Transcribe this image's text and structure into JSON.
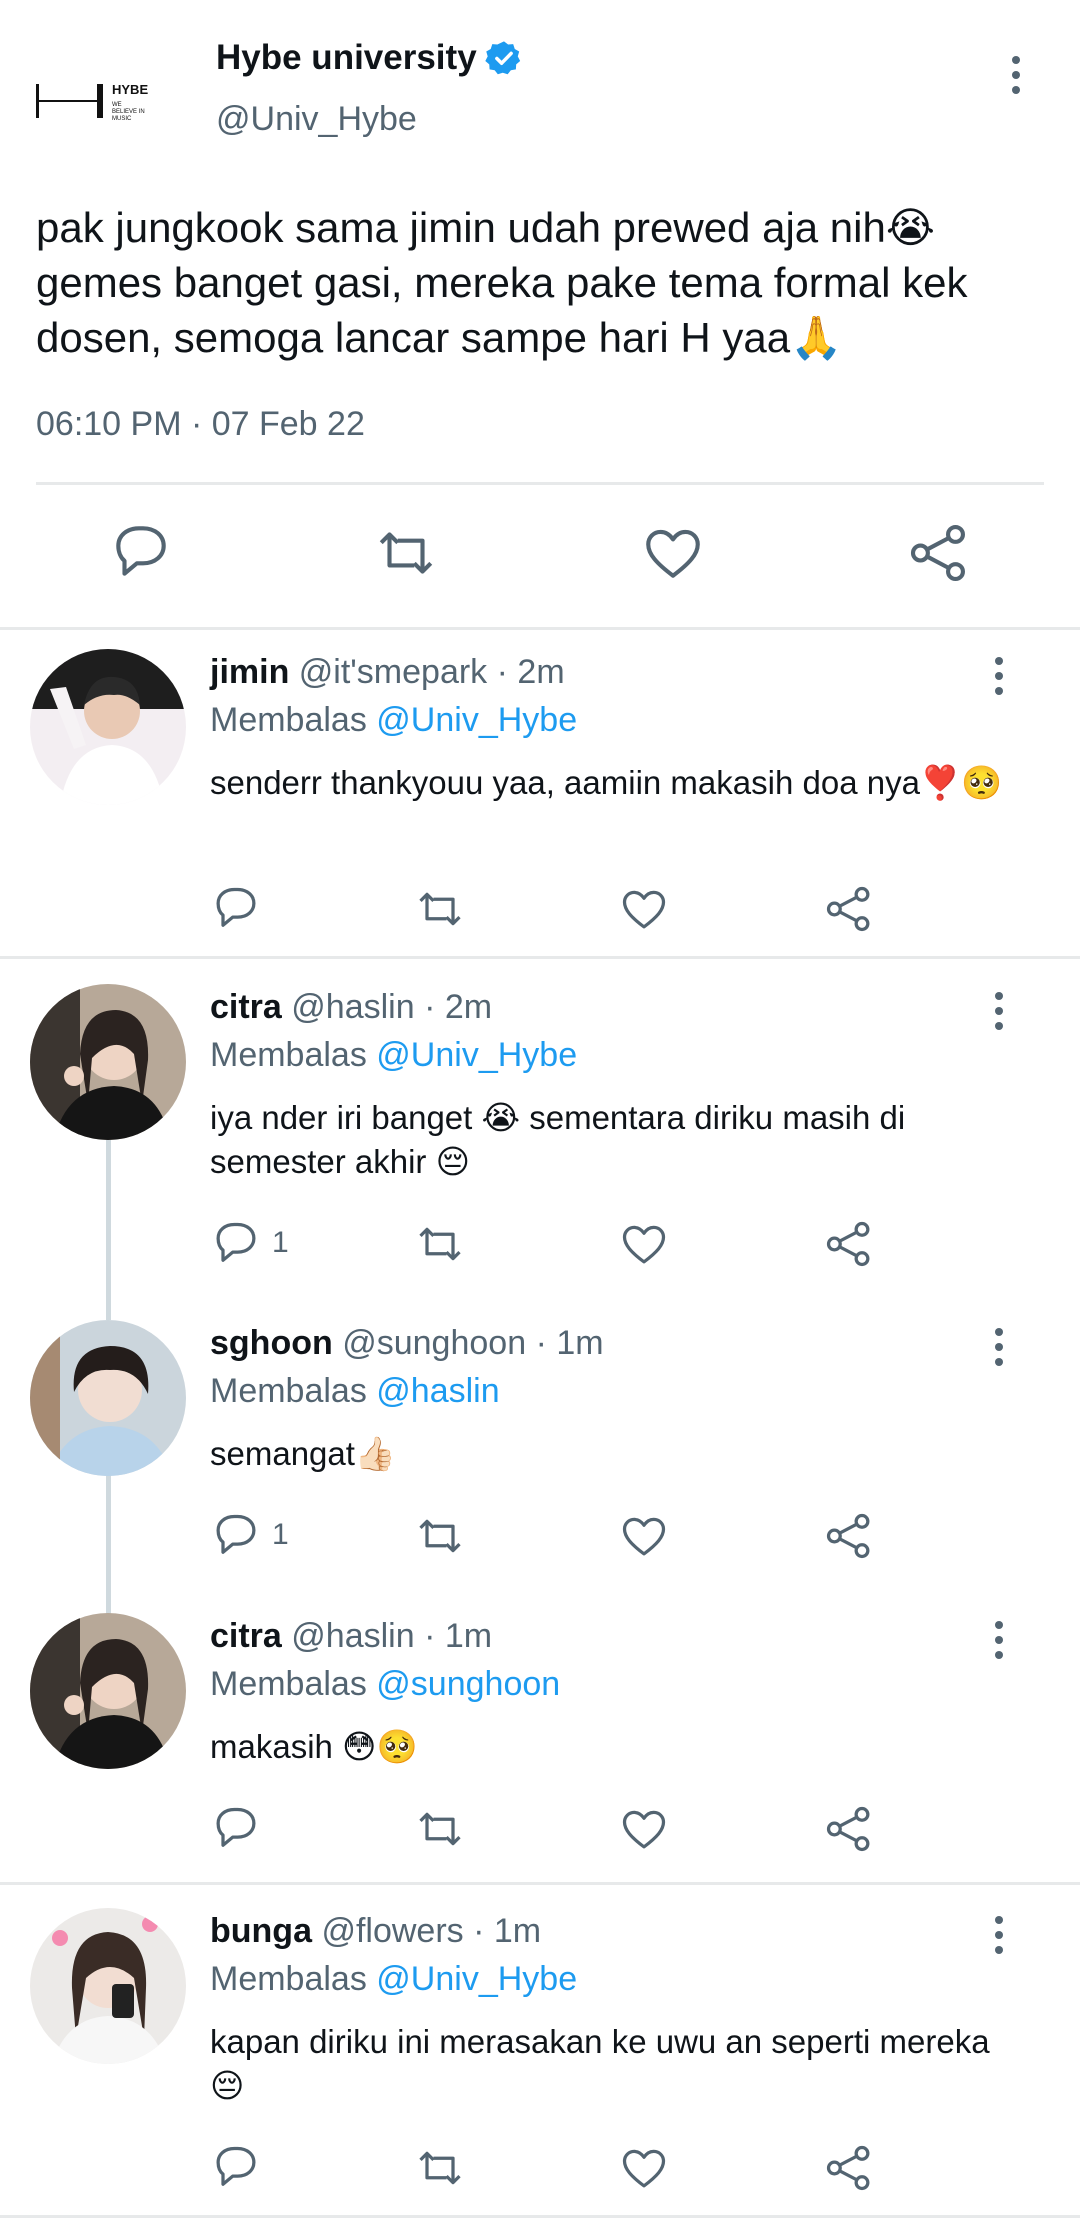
{
  "main_tweet": {
    "author_name": "Hybe university",
    "author_handle": "@Univ_Hybe",
    "avatar_label": "HYBE",
    "avatar_tagline": "WE BELIEVE IN MUSIC",
    "text": "pak jungkook sama jimin udah prewed aja nih😭 gemes banget gasi, mereka pake tema formal kek dosen, semoga lancar sampe hari H yaa🙏",
    "timestamp": "06:10 PM · 07 Feb 22",
    "actions": [
      "reply-icon",
      "retweet-icon",
      "like-icon",
      "share-icon"
    ]
  },
  "replies": [
    {
      "name": "jimin",
      "handle": "@it'smepark",
      "time": "· 2m",
      "reply_prefix": "Membalas",
      "reply_to": "@Univ_Hybe",
      "text": "senderr thankyouu yaa, aamiin makasih doa nya❣️🥺",
      "reply_count": ""
    },
    {
      "name": "citra",
      "handle": "@haslin",
      "time": "· 2m",
      "reply_prefix": "Membalas",
      "reply_to": "@Univ_Hybe",
      "text": "iya nder iri banget 😭 sementara diriku masih di semester akhir 😔",
      "reply_count": "1"
    },
    {
      "name": "sghoon",
      "handle": "@sunghoon",
      "time": "· 1m",
      "reply_prefix": "Membalas",
      "reply_to": "@haslin",
      "text": "semangat👍🏻",
      "reply_count": "1"
    },
    {
      "name": "citra",
      "handle": "@haslin",
      "time": "· 1m",
      "reply_prefix": "Membalas",
      "reply_to": "@sunghoon",
      "text": "makasih 😳🥺",
      "reply_count": ""
    },
    {
      "name": "bunga",
      "handle": "@flowers",
      "time": "· 1m",
      "reply_prefix": "Membalas",
      "reply_to": "@Univ_Hybe",
      "text": "kapan diriku ini merasakan ke uwu an seperti mereka😔",
      "reply_count": ""
    }
  ],
  "colors": {
    "text": "#0f1419",
    "secondary": "#536471",
    "accent": "#1d9bf0",
    "divider": "#e7e9ea"
  }
}
